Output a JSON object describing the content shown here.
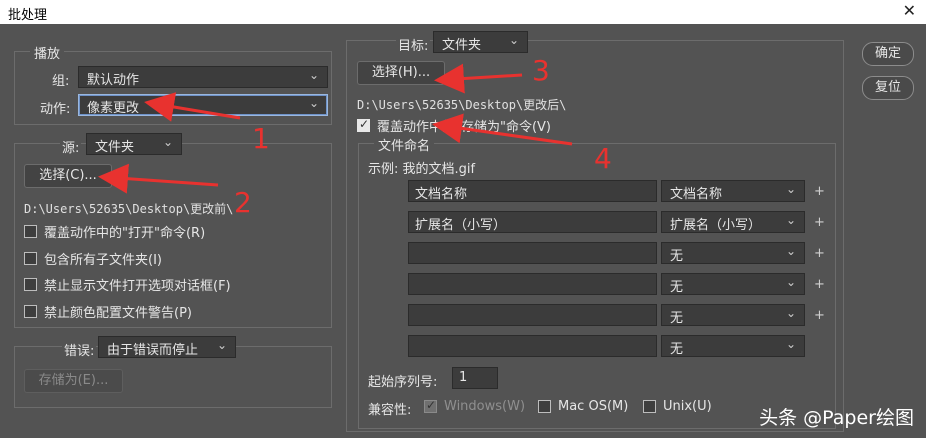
{
  "window": {
    "title": "批处理",
    "close_glyph": "✕"
  },
  "play": {
    "legend": "播放",
    "group_label": "组:",
    "group_value": "默认动作",
    "action_label": "动作:",
    "action_value": "像素更改"
  },
  "source": {
    "label": "源:",
    "value": "文件夹",
    "choose_button": "选择(C)...",
    "path": "D:\\Users\\52635\\Desktop\\更改前\\",
    "options": [
      {
        "label": "覆盖动作中的\"打开\"命令(R)",
        "checked": false
      },
      {
        "label": "包含所有子文件夹(I)",
        "checked": false
      },
      {
        "label": "禁止显示文件打开选项对话框(F)",
        "checked": false
      },
      {
        "label": "禁止颜色配置文件警告(P)",
        "checked": false
      }
    ]
  },
  "errors": {
    "label": "错误:",
    "value": "由于错误而停止",
    "save_as_button": "存储为(E)..."
  },
  "destination": {
    "label": "目标:",
    "value": "文件夹",
    "choose_button": "选择(H)...",
    "path": "D:\\Users\\52635\\Desktop\\更改后\\",
    "override_save": {
      "label": "覆盖动作中的\"存储为\"命令(V)",
      "checked": true
    }
  },
  "naming": {
    "legend": "文件命名",
    "example_label": "示例: 我的文档.gif",
    "rows": [
      {
        "field": "文档名称",
        "select": "文档名称",
        "plus": "+"
      },
      {
        "field": "扩展名（小写）",
        "select": "扩展名（小写）",
        "plus": "+"
      },
      {
        "field": "",
        "select": "无",
        "plus": "+"
      },
      {
        "field": "",
        "select": "无",
        "plus": "+"
      },
      {
        "field": "",
        "select": "无",
        "plus": "+"
      },
      {
        "field": "",
        "select": "无",
        "plus": ""
      }
    ],
    "serial_label": "起始序列号:",
    "serial_value": "1",
    "compat_label": "兼容性:",
    "compat": [
      {
        "label": "Windows(W)",
        "checked": true,
        "disabled": true
      },
      {
        "label": "Mac OS(M)",
        "checked": false,
        "disabled": false
      },
      {
        "label": "Unix(U)",
        "checked": false,
        "disabled": false
      }
    ]
  },
  "buttons": {
    "ok": "确定",
    "reset": "复位"
  },
  "annotations": [
    "1",
    "2",
    "3",
    "4"
  ],
  "annotation_color": "#e8322f",
  "watermark": "头条 @Paper绘图",
  "dropdown_arrow": "⌄"
}
